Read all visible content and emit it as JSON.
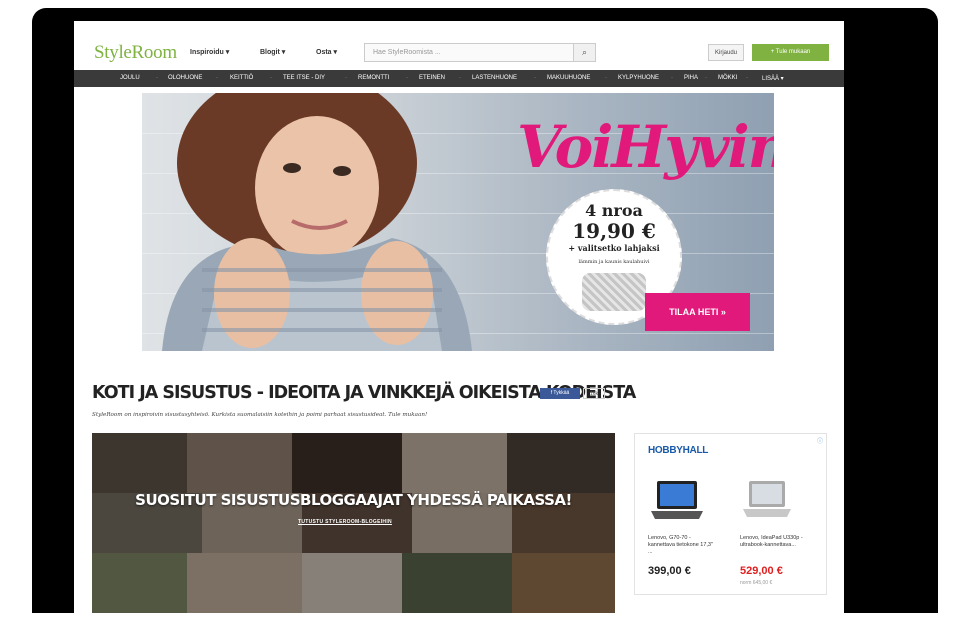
{
  "header": {
    "logo": "StyleRoom",
    "nav": [
      "Inspiroidu ▾",
      "Blogit ▾",
      "Osta ▾"
    ],
    "search_placeholder": "Hae StyleRoomista ...",
    "search_icon": "search-icon",
    "login_label": "Kirjaudu",
    "join_label": "+ Tule mukaan"
  },
  "categories": [
    "JOULU",
    "OLOHUONE",
    "KEITTIÖ",
    "TEE ITSE - DIY",
    "REMONTTI",
    "ETEINEN",
    "LASTENHUONE",
    "MAKUUHUONE",
    "KYLPYHUONE",
    "PIHA",
    "MÖKKI",
    "LISÄÄ ▾"
  ],
  "hero": {
    "brand": "VoiHyvin",
    "offer_line1": "4 nroa",
    "offer_price": "19,90 €",
    "offer_line3": "+ valitsetko lahjaksi",
    "offer_line4": "lämmin ja kaunis kaulahuivi",
    "cta": "TILAA HETI  »"
  },
  "main": {
    "headline": "KOTI JA SISUSTUS - IDEOITA JA VINKKEJÄ OIKEISTA KODEISTA",
    "share_label": "f Tykkää",
    "share_count": "16k",
    "subline": "StyleRoom on inspiroivin sisustusyhteisö. Kurkista suomalaisiin koteihin ja poimi parhaat sisustusideat. Tule mukaan!",
    "collage_title": "SUOSITUT SISUSTUSBLOGGAAJAT YHDESSÄ PAIKASSA!",
    "collage_link": "TUTUSTU STYLEROOM-BLOGEIHIN"
  },
  "ad": {
    "logo": "HOBBYHALL",
    "info_icon": "ⓘ",
    "products": [
      {
        "name": "Lenovo, G70-70 - kannettava tietokone 17,3\" ...",
        "price": "399,00 €",
        "price_color": "#222222",
        "old_price": ""
      },
      {
        "name": "Lenovo, IdeaPad U330p -ultrabook-kannettava...",
        "price": "529,00 €",
        "price_color": "#e02020",
        "old_price": "norm 645,00 €"
      }
    ]
  }
}
